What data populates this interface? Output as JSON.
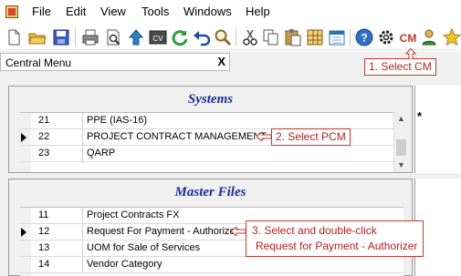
{
  "menu": {
    "items": [
      "File",
      "Edit",
      "View",
      "Tools",
      "Windows",
      "Help"
    ]
  },
  "toolbar": {
    "icons": [
      "new-document-icon",
      "open-folder-icon",
      "save-icon",
      "print-icon",
      "print-preview-icon",
      "upload-arrow-icon",
      "cv-icon",
      "refresh-icon",
      "undo-icon",
      "search-magnifier-icon",
      "cut-icon",
      "copy-icon",
      "paste-icon",
      "grid-icon",
      "calendar-icon",
      "help-icon",
      "gear-icon",
      "cm-icon",
      "user-icon",
      "star-icon"
    ],
    "cm_label": "CM"
  },
  "panel": {
    "title": "Central Menu",
    "close": "X"
  },
  "systems": {
    "title": "Systems",
    "rows": [
      {
        "num": "21",
        "name": "PPE (IAS-16)"
      },
      {
        "num": "22",
        "name": "PROJECT CONTRACT MANAGEMENT"
      },
      {
        "num": "23",
        "name": "QARP"
      }
    ],
    "right_marker": "*"
  },
  "master_files": {
    "title": "Master Files",
    "rows": [
      {
        "num": "11",
        "name": "Project Contracts FX"
      },
      {
        "num": "12",
        "name": "Request For Payment - Authorizer"
      },
      {
        "num": "13",
        "name": "UOM for Sale of Services"
      },
      {
        "num": "14",
        "name": "Vendor Category"
      }
    ]
  },
  "callouts": {
    "step1": "1. Select CM",
    "step2": "2. Select PCM",
    "step3_line1": "3. Select and double-click",
    "step3_line2": "Request for Payment - Authorizer"
  },
  "colors": {
    "accent_red": "#c0392b",
    "section_title_blue": "#1a2e9a"
  }
}
